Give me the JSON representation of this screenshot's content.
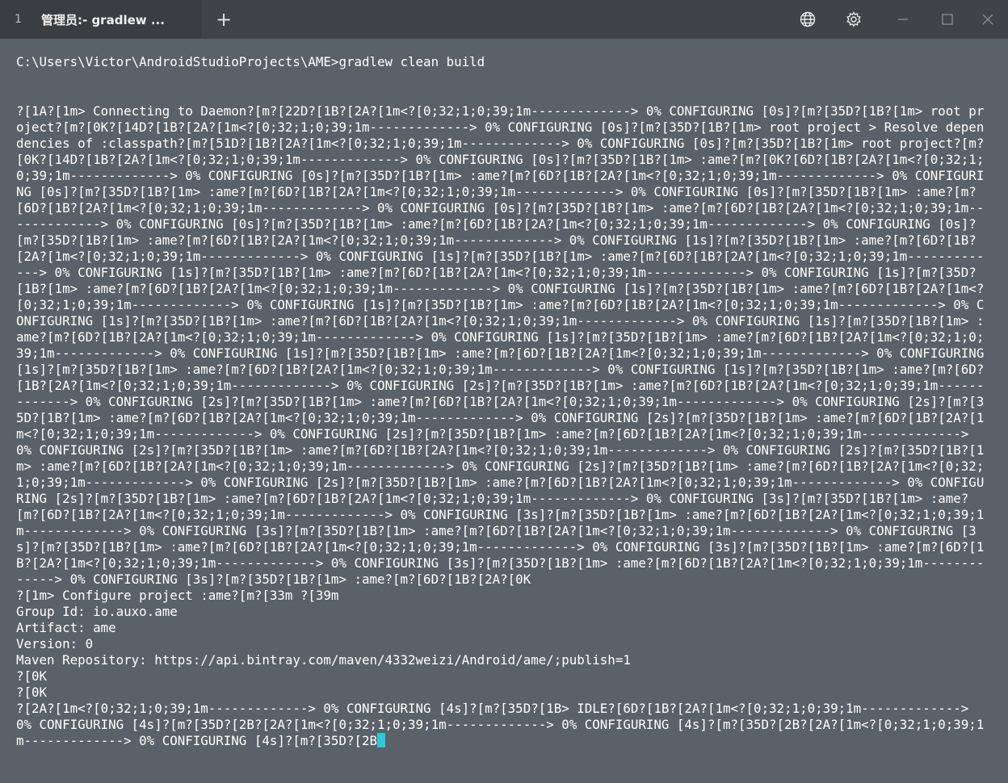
{
  "titlebar": {
    "tab_index": "1",
    "tab_title": "管理员:- gradlew ...",
    "new_tab_label": "+",
    "icons": [
      "globe-icon",
      "gear-icon",
      "minimize-icon",
      "maximize-icon",
      "close-icon"
    ]
  },
  "terminal": {
    "prompt_line": "C:\\Users\\Victor\\AndroidStudioProjects\\AME>gradlew clean build",
    "output": "?[1A?[1m> Connecting to Daemon?[m?[22D?[1B?[2A?[1m<?[0;32;1;0;39;1m-------------> 0% CONFIGURING [0s]?[m?[35D?[1B?[1m> root project?[m?[0K?[14D?[1B?[2A?[1m<?[0;32;1;0;39;1m-------------> 0% CONFIGURING [0s]?[m?[35D?[1B?[1m> root project > Resolve dependencies of :classpath?[m?[51D?[1B?[2A?[1m<?[0;32;1;0;39;1m-------------> 0% CONFIGURING [0s]?[m?[35D?[1B?[1m> root project?[m?[0K?[14D?[1B?[2A?[1m<?[0;32;1;0;39;1m-------------> 0% CONFIGURING [0s]?[m?[35D?[1B?[1m> :ame?[m?[0K?[6D?[1B?[2A?[1m<?[0;32;1;0;39;1m-------------> 0% CONFIGURING [0s]?[m?[35D?[1B?[1m> :ame?[m?[6D?[1B?[2A?[1m<?[0;32;1;0;39;1m-------------> 0% CONFIGURING [0s]?[m?[35D?[1B?[1m> :ame?[m?[6D?[1B?[2A?[1m<?[0;32;1;0;39;1m-------------> 0% CONFIGURING [0s]?[m?[35D?[1B?[1m> :ame?[m?[6D?[1B?[2A?[1m<?[0;32;1;0;39;1m-------------> 0% CONFIGURING [0s]?[m?[35D?[1B?[1m> :ame?[m?[6D?[1B?[2A?[1m<?[0;32;1;0;39;1m-------------> 0% CONFIGURING [0s]?[m?[35D?[1B?[1m> :ame?[m?[6D?[1B?[2A?[1m<?[0;32;1;0;39;1m-------------> 0% CONFIGURING [0s]?[m?[35D?[1B?[1m> :ame?[m?[6D?[1B?[2A?[1m<?[0;32;1;0;39;1m-------------> 0% CONFIGURING [1s]?[m?[35D?[1B?[1m> :ame?[m?[6D?[1B?[2A?[1m<?[0;32;1;0;39;1m-------------> 0% CONFIGURING [1s]?[m?[35D?[1B?[1m> :ame?[m?[6D?[1B?[2A?[1m<?[0;32;1;0;39;1m-------------> 0% CONFIGURING [1s]?[m?[35D?[1B?[1m> :ame?[m?[6D?[1B?[2A?[1m<?[0;32;1;0;39;1m-------------> 0% CONFIGURING [1s]?[m?[35D?[1B?[1m> :ame?[m?[6D?[1B?[2A?[1m<?[0;32;1;0;39;1m-------------> 0% CONFIGURING [1s]?[m?[35D?[1B?[1m> :ame?[m?[6D?[1B?[2A?[1m<?[0;32;1;0;39;1m-------------> 0% CONFIGURING [1s]?[m?[35D?[1B?[1m> :ame?[m?[6D?[1B?[2A?[1m<?[0;32;1;0;39;1m-------------> 0% CONFIGURING [1s]?[m?[35D?[1B?[1m> :ame?[m?[6D?[1B?[2A?[1m<?[0;32;1;0;39;1m-------------> 0% CONFIGURING [1s]?[m?[35D?[1B?[1m> :ame?[m?[6D?[1B?[2A?[1m<?[0;32;1;0;39;1m-------------> 0% CONFIGURING [1s]?[m?[35D?[1B?[1m> :ame?[m?[6D?[1B?[2A?[1m<?[0;32;1;0;39;1m-------------> 0% CONFIGURING [1s]?[m?[35D?[1B?[1m> :ame?[m?[6D?[1B?[2A?[1m<?[0;32;1;0;39;1m-------------> 0% CONFIGURING [1s]?[m?[35D?[1B?[1m> :ame?[m?[6D?[1B?[2A?[1m<?[0;32;1;0;39;1m-------------> 0% CONFIGURING [1s]?[m?[35D?[1B?[1m> :ame?[m?[6D?[1B?[2A?[1m<?[0;32;1;0;39;1m-------------> 0% CONFIGURING [2s]?[m?[35D?[1B?[1m> :ame?[m?[6D?[1B?[2A?[1m<?[0;32;1;0;39;1m-------------> 0% CONFIGURING [2s]?[m?[35D?[1B?[1m> :ame?[m?[6D?[1B?[2A?[1m<?[0;32;1;0;39;1m-------------> 0% CONFIGURING [2s]?[m?[35D?[1B?[1m> :ame?[m?[6D?[1B?[2A?[1m<?[0;32;1;0;39;1m-------------> 0% CONFIGURING [2s]?[m?[35D?[1B?[1m> :ame?[m?[6D?[1B?[2A?[1m<?[0;32;1;0;39;1m-------------> 0% CONFIGURING [2s]?[m?[35D?[1B?[1m> :ame?[m?[6D?[1B?[2A?[1m<?[0;32;1;0;39;1m-------------> 0% CONFIGURING [2s]?[m?[35D?[1B?[1m> :ame?[m?[6D?[1B?[2A?[1m<?[0;32;1;0;39;1m-------------> 0% CONFIGURING [2s]?[m?[35D?[1B?[1m> :ame?[m?[6D?[1B?[2A?[1m<?[0;32;1;0;39;1m-------------> 0% CONFIGURING [2s]?[m?[35D?[1B?[1m> :ame?[m?[6D?[1B?[2A?[1m<?[0;32;1;0;39;1m-------------> 0% CONFIGURING [2s]?[m?[35D?[1B?[1m> :ame?[m?[6D?[1B?[2A?[1m<?[0;32;1;0;39;1m-------------> 0% CONFIGURING [2s]?[m?[35D?[1B?[1m> :ame?[m?[6D?[1B?[2A?[1m<?[0;32;1;0;39;1m-------------> 0% CONFIGURING [3s]?[m?[35D?[1B?[1m> :ame?[m?[6D?[1B?[2A?[1m<?[0;32;1;0;39;1m-------------> 0% CONFIGURING [3s]?[m?[35D?[1B?[1m> :ame?[m?[6D?[1B?[2A?[1m<?[0;32;1;0;39;1m-------------> 0% CONFIGURING [3s]?[m?[35D?[1B?[1m> :ame?[m?[6D?[1B?[2A?[1m<?[0;32;1;0;39;1m-------------> 0% CONFIGURING [3s]?[m?[35D?[1B?[1m> :ame?[m?[6D?[1B?[2A?[1m<?[0;32;1;0;39;1m-------------> 0% CONFIGURING [3s]?[m?[35D?[1B?[1m> :ame?[m?[6D?[1B?[2A?[1m<?[0;32;1;0;39;1m-------------> 0% CONFIGURING [3s]?[m?[35D?[1B?[1m> :ame?[m?[6D?[1B?[2A?[1m<?[0;32;1;0;39;1m-------------> 0% CONFIGURING [3s]?[m?[35D?[1B?[1m> :ame?[m?[6D?[1B?[2A?[0K\n?[1m> Configure project :ame?[m?[33m ?[39m\nGroup Id: io.auxo.ame\nArtifact: ame\nVersion: 0\nMaven Repository: https://api.bintray.com/maven/4332weizi/Android/ame/;publish=1\n?[0K\n?[0K\n?[2A?[1m<?[0;32;1;0;39;1m-------------> 0% CONFIGURING [4s]?[m?[35D?[1B> IDLE?[6D?[1B?[2A?[1m<?[0;32;1;0;39;1m-------------> 0% CONFIGURING [4s]?[m?[35D?[2B?[2A?[1m<?[0;32;1;0;39;1m-------------> 0% CONFIGURING [4s]?[m?[35D?[2B?[2A?[1m<?[0;32;1;0;39;1m-------------> 0% CONFIGURING [4s]?[m?[35D?[2B"
  }
}
